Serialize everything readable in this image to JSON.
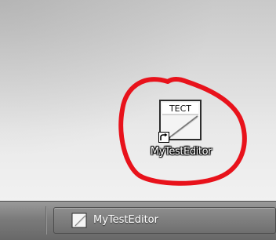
{
  "desktop": {
    "shortcut": {
      "label": "MyTestEditor",
      "icon_text": "TECT",
      "icon": "text-editor-icon",
      "overlay_icon": "shortcut-arrow-icon"
    },
    "annotation_color": "#e8121b"
  },
  "taskbar": {
    "task": {
      "label": "MyTestEditor",
      "icon": "text-editor-icon"
    }
  }
}
